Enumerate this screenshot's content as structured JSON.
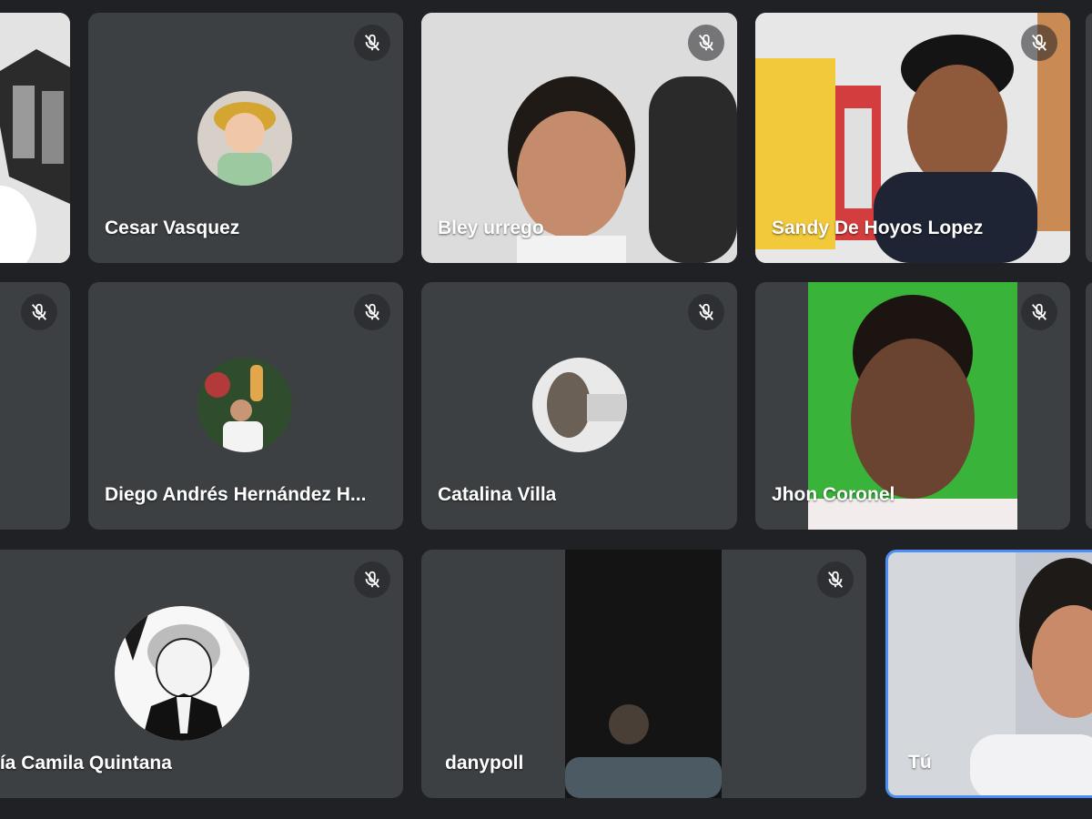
{
  "participants": [
    {
      "name": "",
      "kind": "video"
    },
    {
      "name": "Cesar Vasquez",
      "kind": "avatar"
    },
    {
      "name": "Bley urrego",
      "kind": "video"
    },
    {
      "name": "Sandy De Hoyos Lopez",
      "kind": "video"
    },
    {
      "name": "",
      "kind": "empty"
    },
    {
      "name": "Diego Andrés Hernández H...",
      "kind": "avatar"
    },
    {
      "name": "Catalina Villa",
      "kind": "avatar"
    },
    {
      "name": "Jhon Coronel",
      "kind": "video"
    },
    {
      "name": "aría Camila Quintana",
      "kind": "avatar"
    },
    {
      "name": "danypoll",
      "kind": "video"
    },
    {
      "name": "Tú",
      "kind": "video-self"
    }
  ],
  "icons": {
    "muted": "mic-off-icon"
  },
  "colors": {
    "background": "#202124",
    "tile": "#3c4043",
    "self_highlight": "#4c8df6"
  }
}
